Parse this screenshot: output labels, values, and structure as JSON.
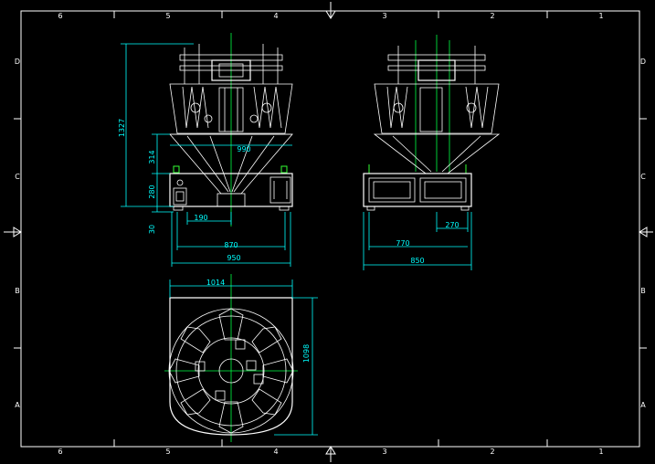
{
  "sheet": {
    "top_zones": [
      "6",
      "5",
      "4",
      "3",
      "2",
      "1"
    ],
    "bottom_zones": [
      "6",
      "5",
      "4",
      "3",
      "2",
      "1"
    ],
    "left_zones": [
      "D",
      "C",
      "B",
      "A"
    ],
    "right_zones": [
      "D",
      "C",
      "B",
      "A"
    ]
  },
  "front_view": {
    "height_total": "1327",
    "hopper_width": "990",
    "hopper_height": "314",
    "frame_height": "280",
    "leg_height": "30",
    "discharge_offset": "190",
    "leg_span": "870",
    "frame_width": "950"
  },
  "side_view": {
    "discharge_offset": "270",
    "leg_span": "770",
    "frame_width": "850"
  },
  "top_view": {
    "width": "1014",
    "depth": "1098"
  },
  "colors": {
    "background": "#000000",
    "lines": "#ffffff",
    "dimensions": "#00ffff",
    "centerlines": "#00ff44"
  }
}
